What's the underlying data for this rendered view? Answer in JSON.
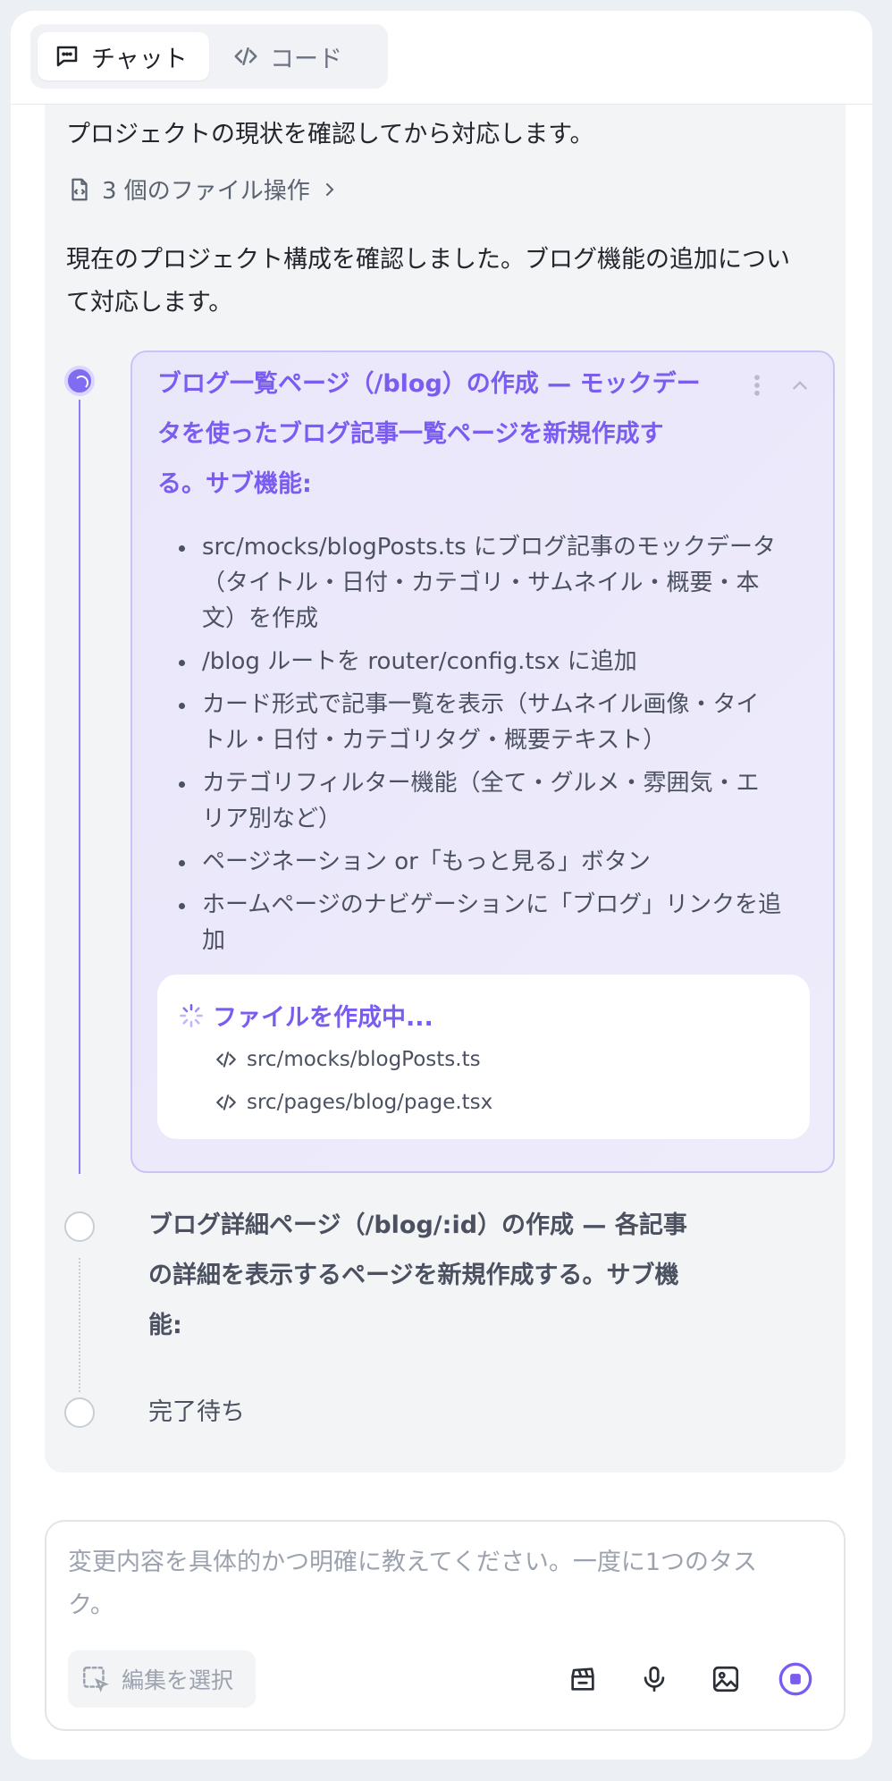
{
  "header": {
    "tabs": [
      {
        "label": "チャット",
        "icon": "chat-icon",
        "active": true
      },
      {
        "label": "コード",
        "icon": "code-icon",
        "active": false
      }
    ]
  },
  "conversation": {
    "intro": "プロジェクトの現状を確認してから対応します。",
    "file_ops": "3 個のファイル操作",
    "summary_line1": "現在のプロジェクト構成を確認しました。ブログ機能の追加につい",
    "summary_line2": "て対応します。",
    "task1": {
      "title_line1": "ブログ一覧ページ（/blog）の作成 — モックデー",
      "title_line2": "タを使ったブログ記事一覧ページを新規作成す",
      "title_line3": "る。サブ機能:",
      "bullets": [
        {
          "line1": "src/mocks/blogPosts.ts にブログ記事のモックデータ",
          "line2": "（タイトル・日付・カテゴリ・サムネイル・概要・本",
          "line3": "文）を作成"
        },
        {
          "line1": "/blog ルートを router/config.tsx に追加"
        },
        {
          "line1": "カード形式で記事一覧を表示（サムネイル画像・タイ",
          "line2": "トル・日付・カテゴリタグ・概要テキスト）"
        },
        {
          "line1": "カテゴリフィルター機能（全て・グルメ・雰囲気・エ",
          "line2": "リア別など）"
        },
        {
          "line1": "ページネーション or「もっと見る」ボタン"
        },
        {
          "line1": "ホームページのナビゲーションに「ブログ」リンクを追",
          "line2": "加"
        }
      ],
      "creating_label": "ファイルを作成中...",
      "files": [
        "src/mocks/blogPosts.ts",
        "src/pages/blog/page.tsx"
      ]
    },
    "task2": {
      "title_line1": "ブログ詳細ページ（/blog/:id）の作成 — 各記事",
      "title_line2": "の詳細を表示するページを新規作成する。サブ機",
      "title_line3": "能:"
    },
    "task3": {
      "title": "完了待ち"
    }
  },
  "input": {
    "placeholder_line1": "変更内容を具体的かつ明確に教えてください。一度に1つのタス",
    "placeholder_line2": "ク。",
    "edit_select_label": "編集を選択"
  },
  "colors": {
    "accent": "#7b5cf0",
    "panel_bg": "#f3f4f6"
  }
}
